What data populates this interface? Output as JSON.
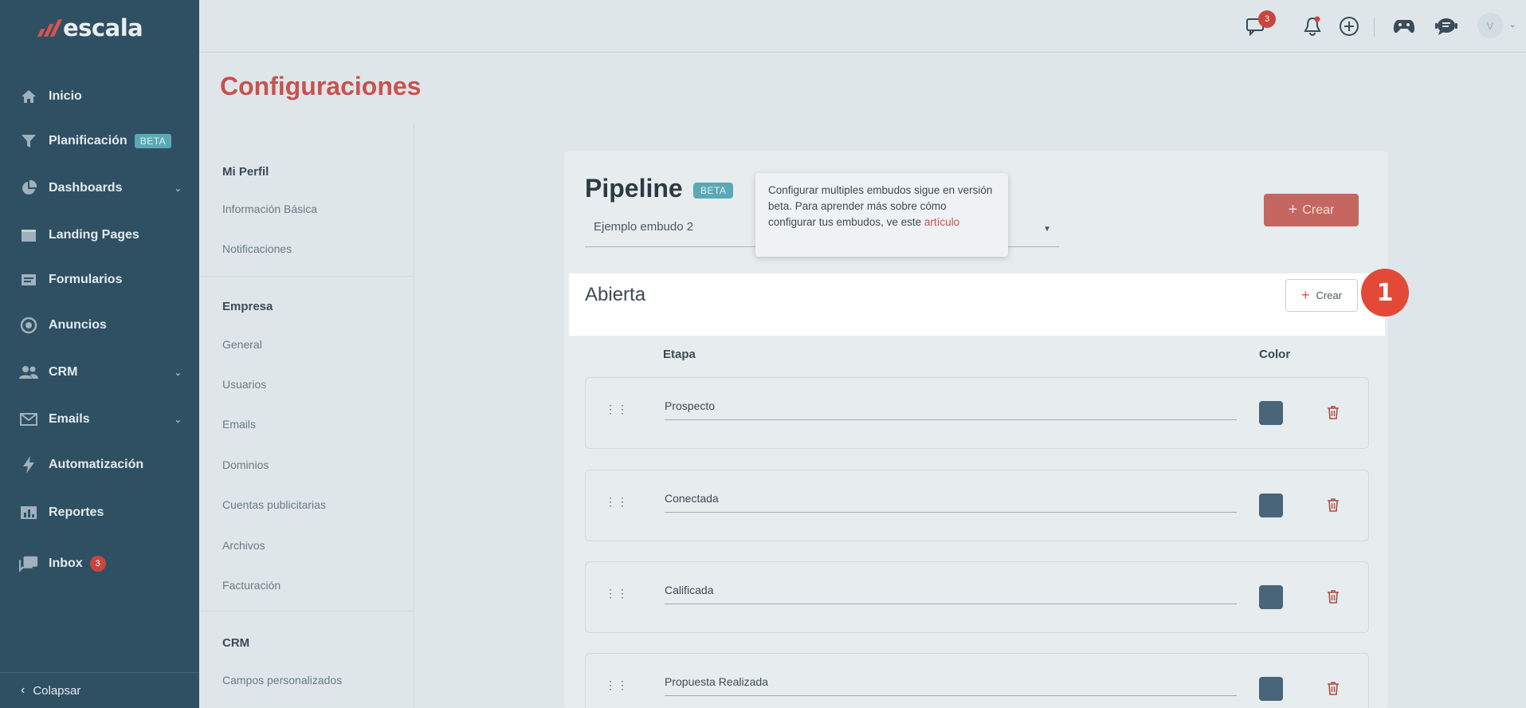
{
  "brand": {
    "name": "escala",
    "colors": {
      "sidebar": "#2f5063",
      "accent": "#c8524e",
      "badge": "#5aa9b5",
      "highlight_marker": "#e24a37"
    }
  },
  "sidebar": {
    "items": [
      {
        "label": "Inicio",
        "icon": "home-icon"
      },
      {
        "label": "Planificación",
        "icon": "funnel-icon",
        "badge": "BETA"
      },
      {
        "label": "Dashboards",
        "icon": "pie-chart-icon",
        "expandable": true
      },
      {
        "label": "Landing Pages",
        "icon": "window-icon"
      },
      {
        "label": "Formularios",
        "icon": "form-icon"
      },
      {
        "label": "Anuncios",
        "icon": "target-icon"
      },
      {
        "label": "CRM",
        "icon": "users-icon",
        "expandable": true
      },
      {
        "label": "Emails",
        "icon": "envelope-icon",
        "expandable": true
      },
      {
        "label": "Automatización",
        "icon": "bolt-icon"
      },
      {
        "label": "Reportes",
        "icon": "bar-chart-icon"
      },
      {
        "label": "Inbox",
        "icon": "chat-icon",
        "badge": "3"
      }
    ],
    "collapse_label": "Colapsar"
  },
  "topbar": {
    "messages_count": "3",
    "avatar_initial": "V"
  },
  "page": {
    "title": "Configuraciones"
  },
  "settings_menu": {
    "sections": [
      {
        "heading": "Mi Perfil",
        "items": [
          "Información Básica",
          "Notificaciones"
        ]
      },
      {
        "heading": "Empresa",
        "items": [
          "General",
          "Usuarios",
          "Emails",
          "Dominios",
          "Cuentas publicitarias",
          "Archivos",
          "Facturación"
        ]
      },
      {
        "heading": "CRM",
        "items": [
          "Campos personalizados"
        ]
      }
    ]
  },
  "pipeline": {
    "title": "Pipeline",
    "badge": "BETA",
    "selected_funnel": "Ejemplo embudo 2",
    "create_label": "Crear",
    "tooltip_text": "Configurar multiples embudos sigue en versión beta. Para aprender más sobre cómo configurar tus embudos, ve este",
    "tooltip_link": "artículo",
    "stage_group": {
      "name": "Abierta",
      "create_label": "Crear"
    },
    "step_marker": "1",
    "columns": {
      "stage": "Etapa",
      "color": "Color"
    },
    "stages": [
      {
        "name": "Prospecto",
        "color": "#48657a"
      },
      {
        "name": "Conectada",
        "color": "#48657a"
      },
      {
        "name": "Calificada",
        "color": "#48657a"
      },
      {
        "name": "Propuesta Realizada",
        "color": "#48657a"
      }
    ]
  }
}
